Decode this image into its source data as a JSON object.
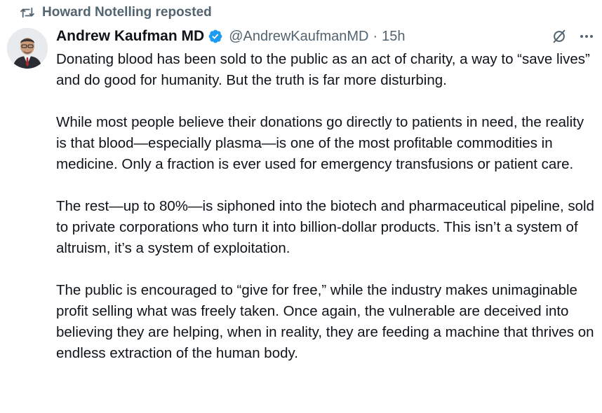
{
  "repost": {
    "icon": "repost-icon",
    "text": "Howard Notelling reposted"
  },
  "author": {
    "display_name": "Andrew Kaufman MD",
    "verified_icon": "verified-badge-icon",
    "verified_color": "#1d9bf0",
    "handle": "@AndrewKaufmanMD",
    "separator": "·",
    "time": "15h",
    "avatar_icon": "avatar"
  },
  "actions": {
    "grok_icon": "grok-icon",
    "more_icon": "more-options-icon"
  },
  "tweet": {
    "paragraphs": [
      "Donating blood has been sold to the public as an act of charity, a way to “save lives” and do good for humanity. But the truth is far more disturbing.",
      "While most people believe their donations go directly to patients in need, the reality is that blood—especially plasma—is one of the most profitable commodities in medicine. Only a fraction is ever used for emergency transfusions or patient care.",
      "The rest—up to 80%—is siphoned into the biotech and pharmaceutical pipeline, sold to private corporations who turn it into billion-dollar products. This isn’t a system of altruism, it’s a system of exploitation.",
      "The public is encouraged to “give for free,” while the industry makes unimaginable profit selling what was freely taken. Once again, the vulnerable are deceived into believing they are helping, when in reality, they are feeding a machine that thrives on endless extraction of the human body."
    ]
  },
  "colors": {
    "text_primary": "#0f1419",
    "text_secondary": "#536471",
    "accent": "#1d9bf0"
  }
}
